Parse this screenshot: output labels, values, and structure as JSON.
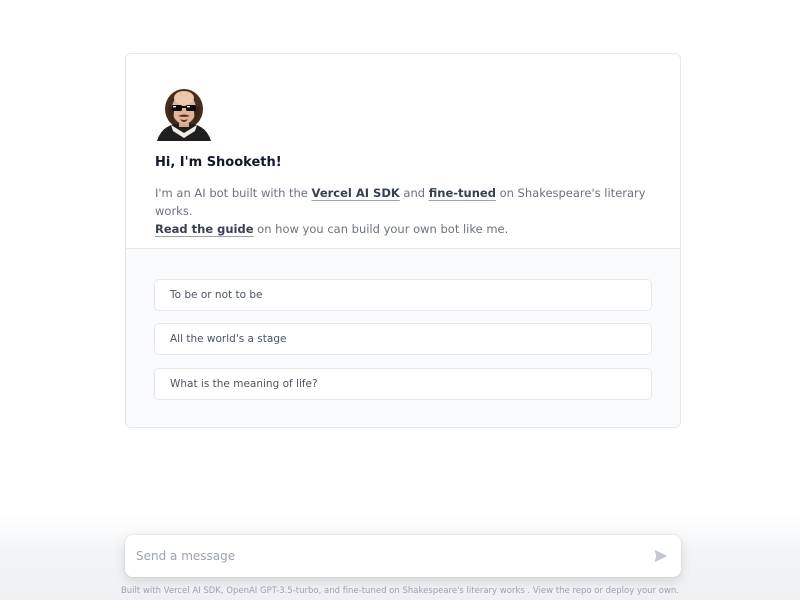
{
  "hero": {
    "avatar_icon": "shakespeare-sunglasses-avatar",
    "greeting": "Hi, I'm Shooketh!",
    "intro": {
      "part1": "I'm an AI bot built with the ",
      "link1": "Vercel AI SDK",
      "part2": " and ",
      "link2": "fine-tuned",
      "part3": " on Shakespeare's literary works.",
      "link3": "Read the guide",
      "part4": " on how you can build your own bot like me."
    }
  },
  "suggestions": [
    "To be or not to be",
    "All the world's a stage",
    "What is the meaning of life?"
  ],
  "composer": {
    "placeholder": "Send a message",
    "value": "",
    "send_icon": "send-arrow-icon"
  },
  "footer": {
    "text": "Built with Vercel AI SDK, OpenAI GPT-3.5-turbo, and fine-tuned on Shakespeare's literary works . View the repo or deploy your own."
  },
  "colors": {
    "text": "#111827",
    "muted": "#6b7280",
    "border": "#e5e7eb",
    "panel": "#f9fafb"
  }
}
